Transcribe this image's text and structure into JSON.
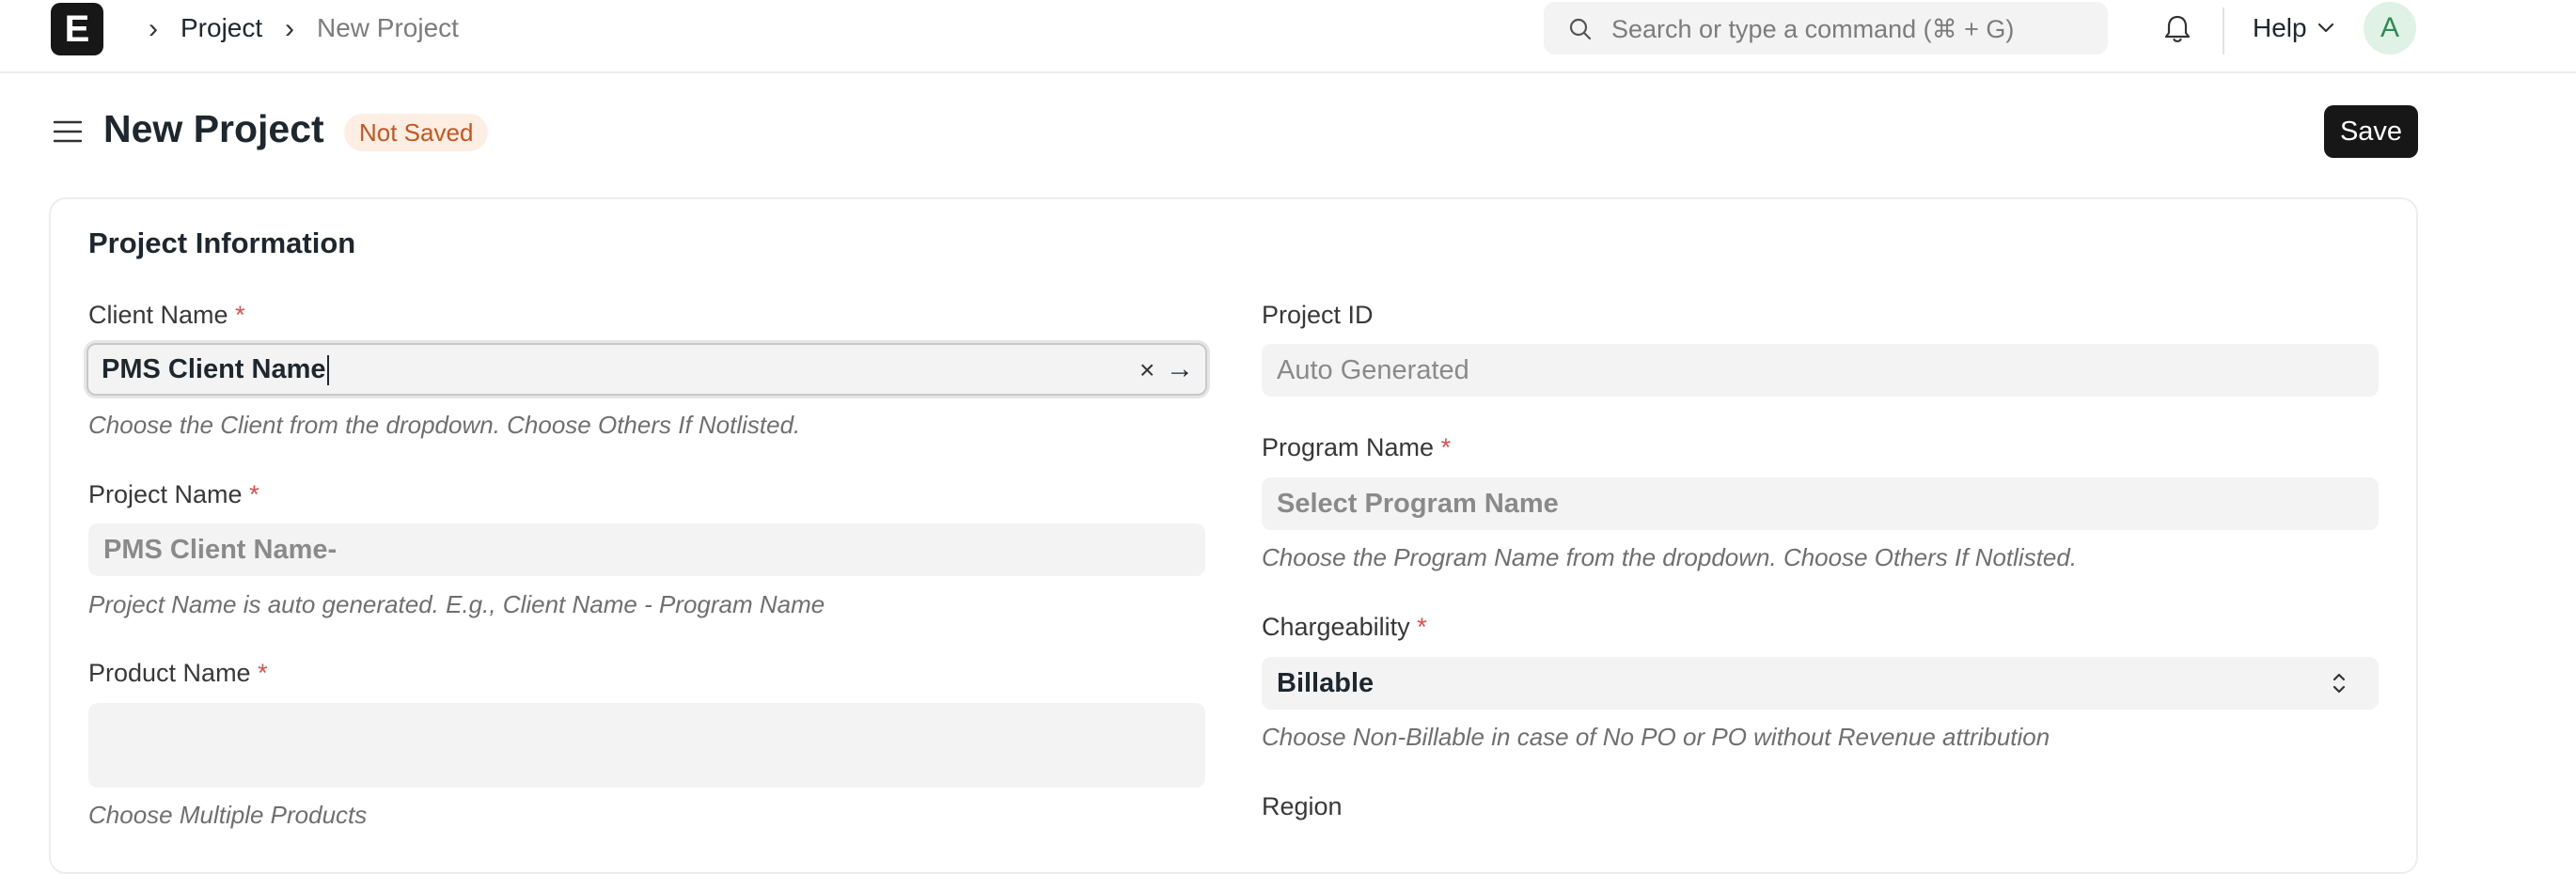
{
  "navbar": {
    "logo_letter": "E",
    "breadcrumbs": [
      "Project",
      "New Project"
    ],
    "search_placeholder": "Search or type a command (⌘ + G)",
    "help_label": "Help",
    "avatar_initial": "A"
  },
  "header": {
    "title": "New Project",
    "status_badge": "Not Saved",
    "save_label": "Save"
  },
  "form": {
    "section_title": "Project Information",
    "client_name": {
      "label": "Client Name",
      "required": "*",
      "value": "PMS Client Name",
      "help": "Choose the Client from the dropdown. Choose Others If Notlisted."
    },
    "project_id": {
      "label": "Project ID",
      "placeholder": "Auto Generated"
    },
    "project_name": {
      "label": "Project Name",
      "required": "*",
      "value": "PMS Client Name-",
      "help": "Project Name is auto generated. E.g., Client Name - Program Name"
    },
    "program_name": {
      "label": "Program Name",
      "required": "*",
      "placeholder": "Select Program Name",
      "help": "Choose the Program Name from the dropdown. Choose Others If Notlisted."
    },
    "product_name": {
      "label": "Product Name",
      "required": "*",
      "value": "",
      "help": "Choose Multiple Products"
    },
    "chargeability": {
      "label": "Chargeability",
      "required": "*",
      "value": "Billable",
      "help": "Choose Non-Billable in case of No PO or PO without Revenue attribution"
    },
    "region": {
      "label": "Region"
    }
  },
  "icons": [
    "search-icon",
    "bell-icon",
    "chevron-down-icon",
    "hamburger-icon",
    "clear-icon",
    "arrow-right-icon",
    "select-arrows-icon"
  ]
}
